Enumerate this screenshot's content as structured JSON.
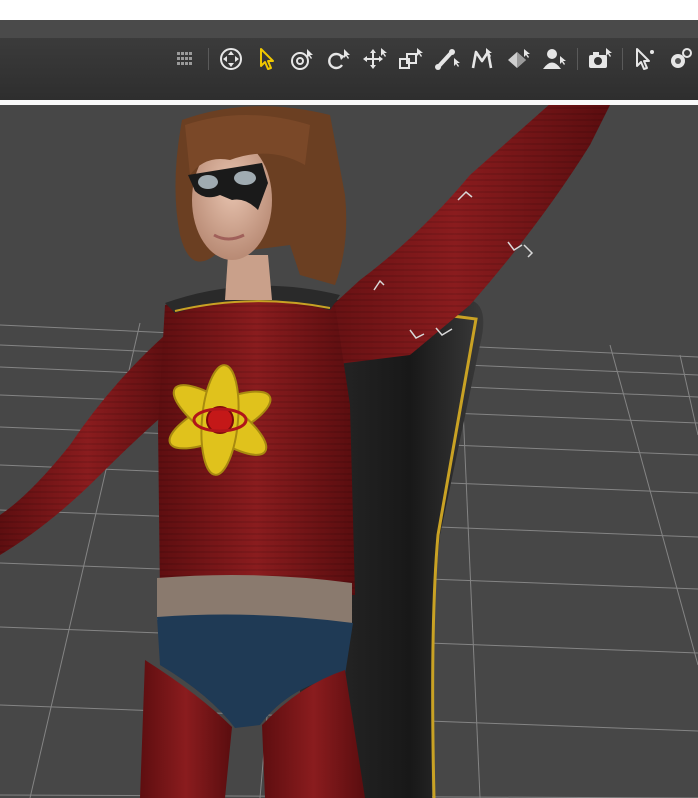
{
  "window": {
    "title": ""
  },
  "toolbar": {
    "tools": [
      {
        "name": "grid-toggle-tool",
        "icon": "grid-icon"
      },
      {
        "name": "universal-tool",
        "icon": "target-icon"
      },
      {
        "name": "select-tool",
        "icon": "arrow-pointer-icon",
        "active": true
      },
      {
        "name": "orbit-tool",
        "icon": "orbit-icon"
      },
      {
        "name": "rotate-tool",
        "icon": "rotate-icon"
      },
      {
        "name": "translate-tool",
        "icon": "move-arrows-icon"
      },
      {
        "name": "scale-tool",
        "icon": "scale-icon"
      },
      {
        "name": "joint-editor-tool",
        "icon": "bone-icon"
      },
      {
        "name": "morph-brush-tool",
        "icon": "morph-m-icon"
      },
      {
        "name": "geometry-tool",
        "icon": "geometry-icon"
      },
      {
        "name": "figure-tool",
        "icon": "figure-icon"
      },
      {
        "name": "camera-tool",
        "icon": "camera-icon"
      },
      {
        "name": "node-select-tool",
        "icon": "node-pointer-icon"
      },
      {
        "name": "light-tool",
        "icon": "light-gear-icon"
      },
      {
        "name": "camera-2-tool",
        "icon": "camera-icon"
      }
    ]
  },
  "colors": {
    "toolbar_bg": "#333333",
    "viewport_bg": "#474747",
    "grid_line": "#8a8a8a",
    "suit_red": "#7a1416",
    "emblem_yellow": "#e0c21c",
    "cape_black": "#1e1e1e",
    "belt": "#8a7a6e",
    "shorts": "#1f3a55",
    "hair": "#6b3f22",
    "skin": "#d9b3a0",
    "accent_tool": "#f0c800"
  },
  "viewport": {
    "scene": "superhero-figure-with-cape-and-atom-emblem"
  }
}
